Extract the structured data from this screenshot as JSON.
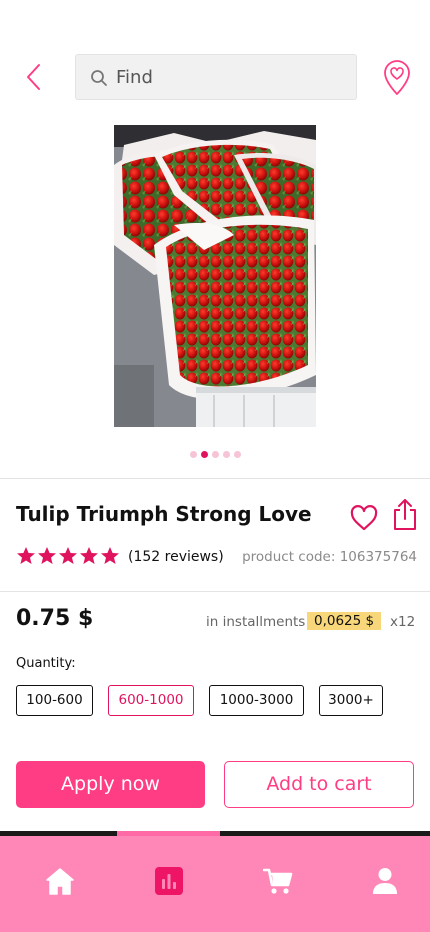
{
  "header": {
    "search_placeholder": "Find",
    "back_icon": "chevron-left-icon",
    "location_icon": "heart-location-pin-icon"
  },
  "gallery": {
    "image": "red tulip bouquets in white paper wrapping",
    "pages": 5,
    "active_page": 2
  },
  "product": {
    "title": "Tulip Triumph Strong Love",
    "rating": 5,
    "reviews": "(152 reviews)",
    "code": "product code: 106375764",
    "price": "0.75 $",
    "installments_label": "in installments",
    "installments_amount": "0,0625 $",
    "installments_times": "x12"
  },
  "quantity": {
    "label": "Quantity:",
    "options": [
      "100-600",
      "600-1000",
      "1000-3000",
      "3000+"
    ],
    "selected": "600-1000"
  },
  "actions": {
    "apply": "Apply now",
    "add_to_cart": "Add to cart"
  },
  "bottom_nav": {
    "items": [
      "home-icon",
      "chart-icon",
      "cart-icon",
      "profile-icon"
    ],
    "active": "chart-icon"
  },
  "colors": {
    "accent": "#ff3d84",
    "accent_dark": "#e0145e",
    "nav_background": "#ff87b7",
    "installment_highlight": "#f8d77a"
  }
}
